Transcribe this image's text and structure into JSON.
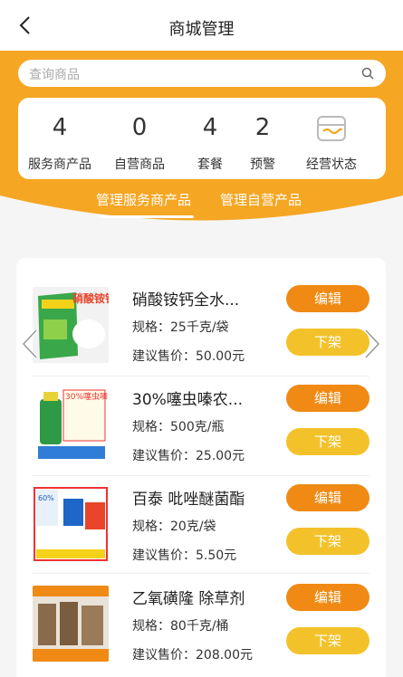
{
  "header": {
    "title": "商城管理"
  },
  "search": {
    "placeholder": "查询商品"
  },
  "stats": [
    {
      "value": "4",
      "label": "服务商产品"
    },
    {
      "value": "0",
      "label": "自营商品"
    },
    {
      "value": "4",
      "label": "套餐"
    },
    {
      "value": "2",
      "label": "预警"
    }
  ],
  "status": {
    "label": "经营状态"
  },
  "tabs": [
    {
      "label": "管理服务商产品",
      "active": true
    },
    {
      "label": "管理自营产品",
      "active": false
    }
  ],
  "products": [
    {
      "name": "硝酸铵钙全水...",
      "spec": "规格：25千克/袋",
      "price": "建议售价：50.00元",
      "thumb_text": "硝酸铵钙",
      "edit": "编辑",
      "off": "下架"
    },
    {
      "name": "30%噻虫嗪农...",
      "spec": "规格：500克/瓶",
      "price": "建议售价：25.00元",
      "thumb_text": "30%噻虫嗪",
      "edit": "编辑",
      "off": "下架"
    },
    {
      "name": "百泰 吡唑醚菌酯",
      "spec": "规格：20克/袋",
      "price": "建议售价：5.50元",
      "thumb_text": "60%",
      "edit": "编辑",
      "off": "下架"
    },
    {
      "name": "乙氧磺隆 除草剂",
      "spec": "规格：80千克/桶",
      "price": "建议售价：208.00元",
      "thumb_text": "",
      "edit": "编辑",
      "off": "下架"
    }
  ],
  "colors": {
    "accent": "#f08a14",
    "yellow": "#f3c22b",
    "hero": "#f5a623"
  }
}
